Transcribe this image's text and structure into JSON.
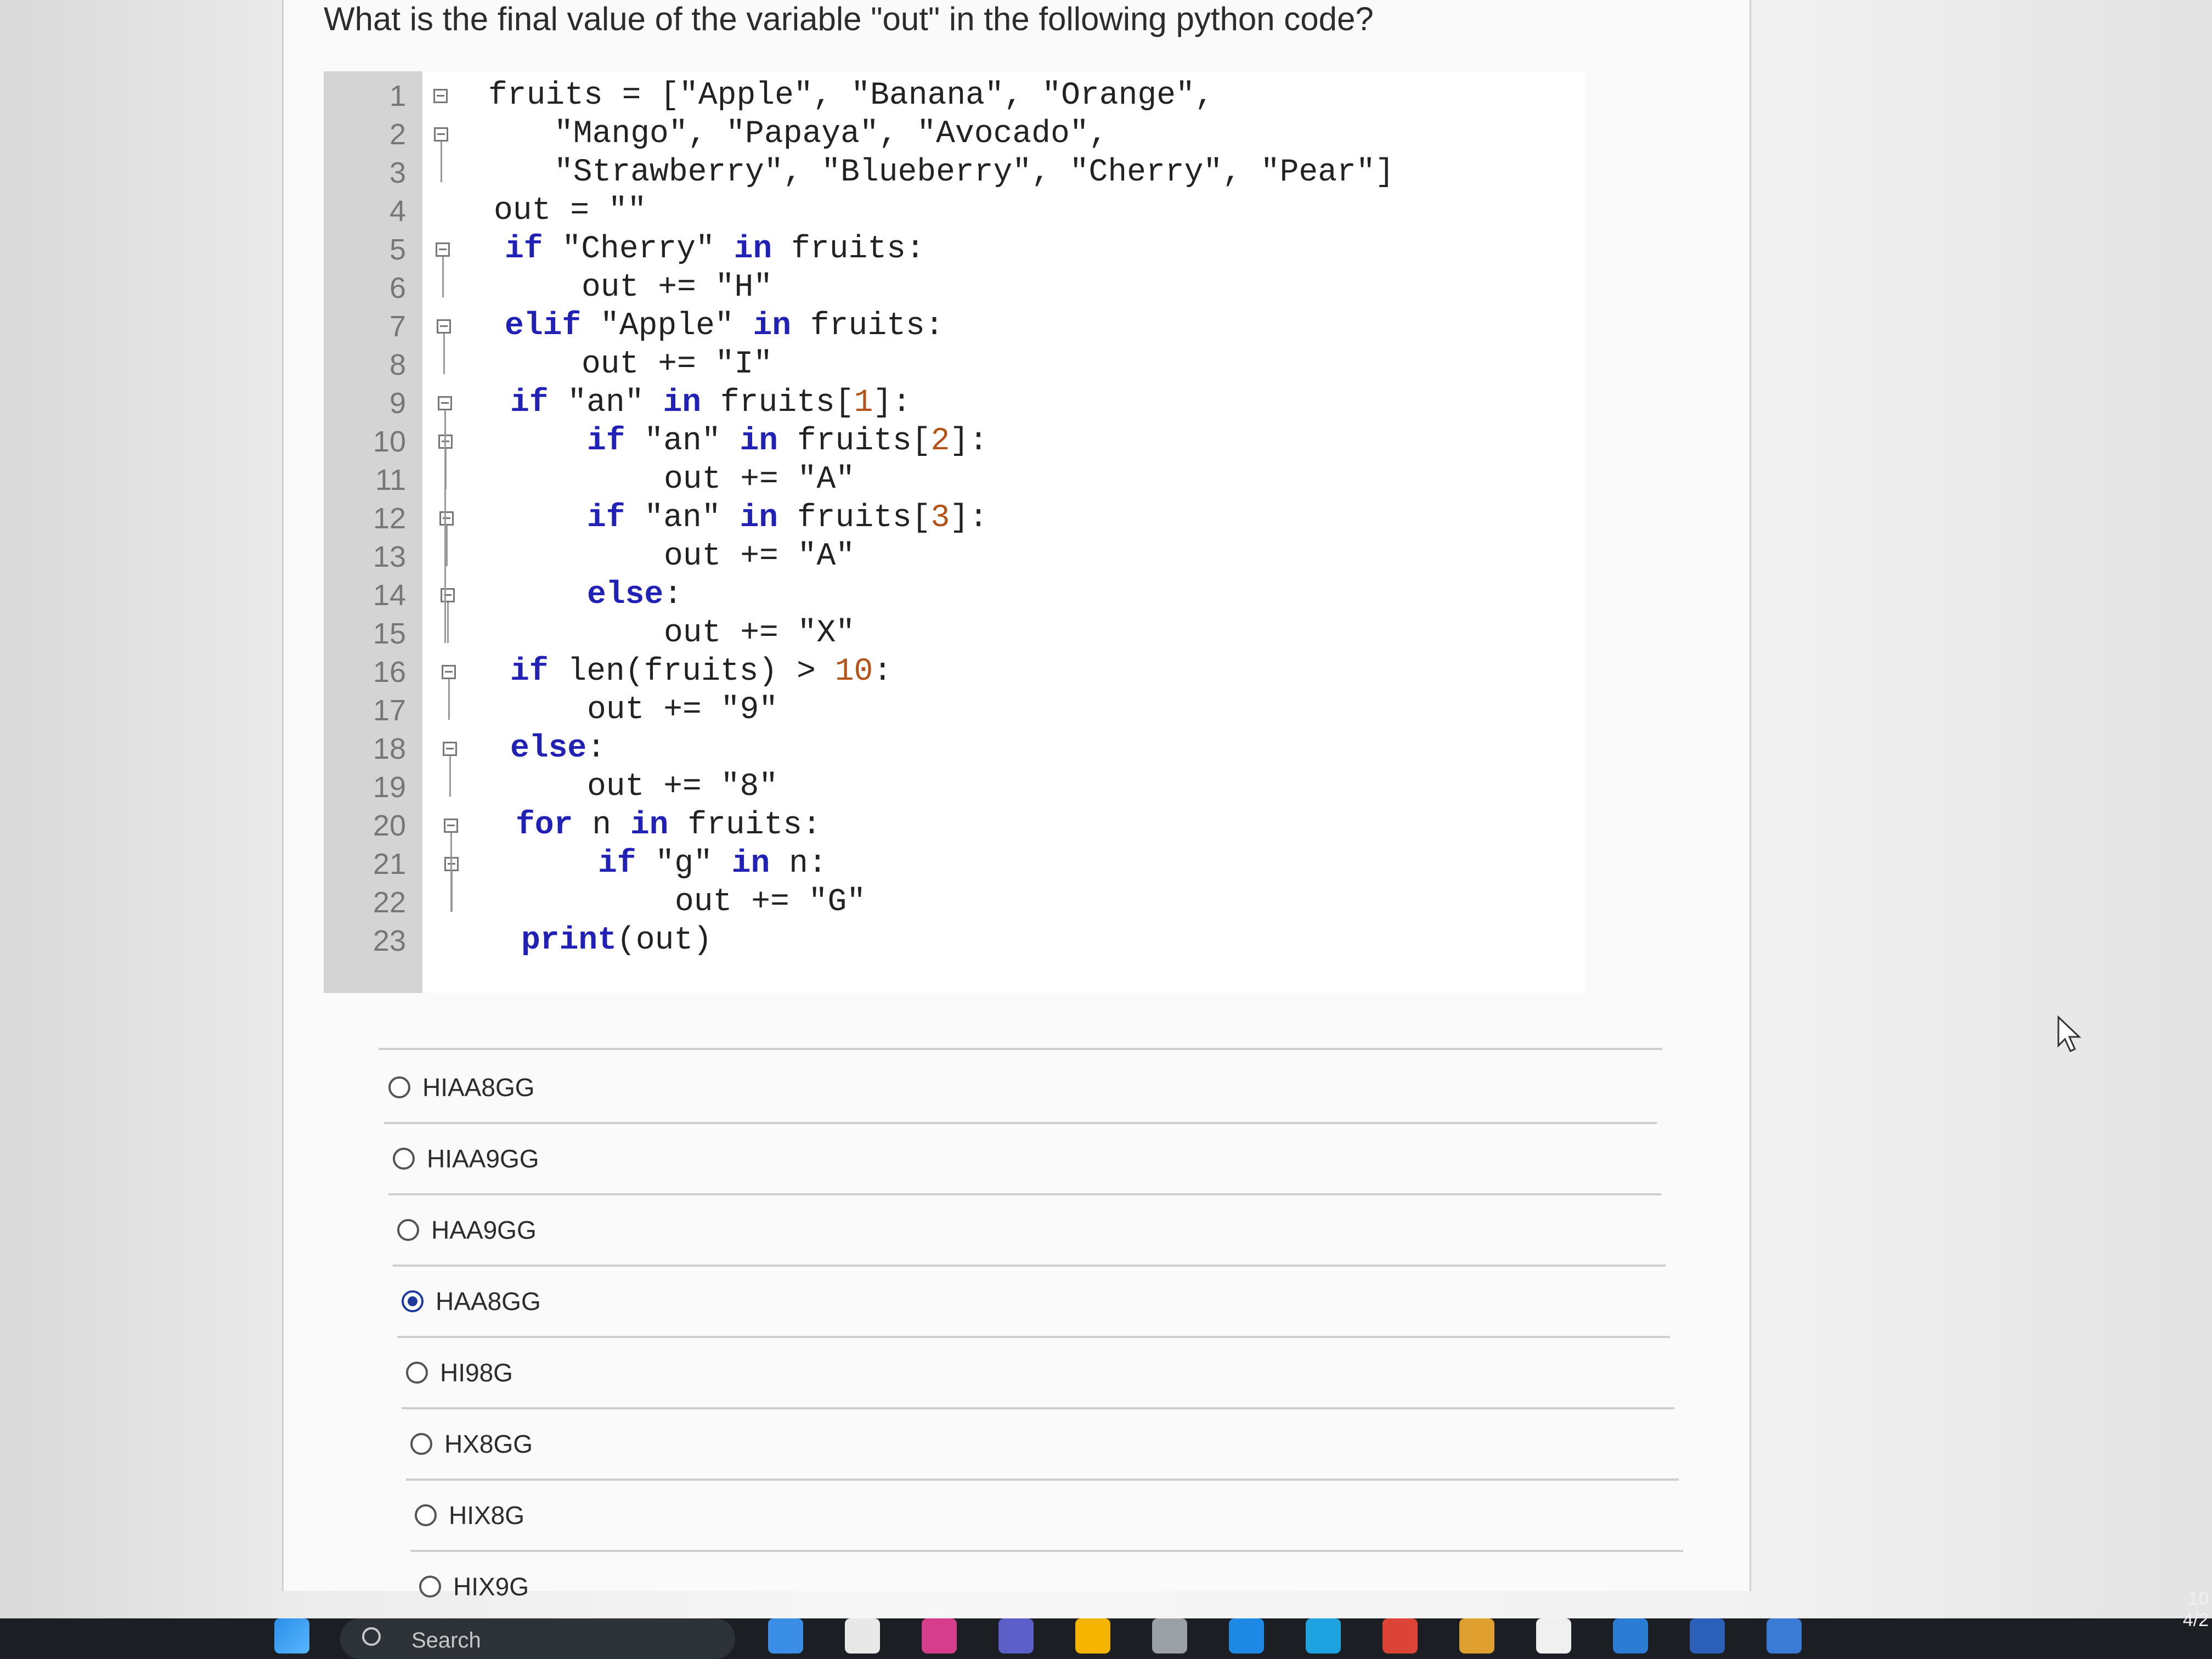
{
  "question": {
    "text": "What is the final value of the variable \"out\" in the following python code?"
  },
  "code": {
    "line_numbers": [
      "1",
      "2",
      "3",
      "4",
      "5",
      "6",
      "7",
      "8",
      "9",
      "10",
      "11",
      "12",
      "13",
      "14",
      "15",
      "16",
      "17",
      "18",
      "19",
      "20",
      "21",
      "22",
      "23"
    ],
    "lines": [
      {
        "parts": [
          {
            "t": "fruits = [\"Apple\", \"Banana\", \"Orange\",",
            "c": ""
          }
        ]
      },
      {
        "parts": [
          {
            "t": "\"Mango\", \"Papaya\", \"Avocado\",",
            "c": ""
          }
        ]
      },
      {
        "parts": [
          {
            "t": "\"Strawberry\", \"Blueberry\", \"Cherry\", \"Pear\"]",
            "c": ""
          }
        ]
      },
      {
        "parts": [
          {
            "t": "out = \"\"",
            "c": ""
          }
        ]
      },
      {
        "parts": [
          {
            "t": "if",
            "c": "kw"
          },
          {
            "t": " \"Cherry\" ",
            "c": ""
          },
          {
            "t": "in",
            "c": "kw"
          },
          {
            "t": " fruits:",
            "c": ""
          }
        ]
      },
      {
        "parts": [
          {
            "t": "out += \"H\"",
            "c": ""
          }
        ]
      },
      {
        "parts": [
          {
            "t": "elif",
            "c": "kw"
          },
          {
            "t": " \"Apple\" ",
            "c": ""
          },
          {
            "t": "in",
            "c": "kw"
          },
          {
            "t": " fruits:",
            "c": ""
          }
        ]
      },
      {
        "parts": [
          {
            "t": "out += \"I\"",
            "c": ""
          }
        ]
      },
      {
        "parts": [
          {
            "t": "if",
            "c": "kw"
          },
          {
            "t": " \"an\" ",
            "c": ""
          },
          {
            "t": "in",
            "c": "kw"
          },
          {
            "t": " fruits[",
            "c": ""
          },
          {
            "t": "1",
            "c": "num"
          },
          {
            "t": "]:",
            "c": ""
          }
        ]
      },
      {
        "parts": [
          {
            "t": "if",
            "c": "kw"
          },
          {
            "t": " \"an\" ",
            "c": ""
          },
          {
            "t": "in",
            "c": "kw"
          },
          {
            "t": " fruits[",
            "c": ""
          },
          {
            "t": "2",
            "c": "num"
          },
          {
            "t": "]:",
            "c": ""
          }
        ]
      },
      {
        "parts": [
          {
            "t": "out += \"A\"",
            "c": ""
          }
        ]
      },
      {
        "parts": [
          {
            "t": "if",
            "c": "kw"
          },
          {
            "t": " \"an\" ",
            "c": ""
          },
          {
            "t": "in",
            "c": "kw"
          },
          {
            "t": " fruits[",
            "c": ""
          },
          {
            "t": "3",
            "c": "num"
          },
          {
            "t": "]:",
            "c": ""
          }
        ]
      },
      {
        "parts": [
          {
            "t": "out += \"A\"",
            "c": ""
          }
        ]
      },
      {
        "parts": [
          {
            "t": "else",
            "c": "kw"
          },
          {
            "t": ":",
            "c": ""
          }
        ]
      },
      {
        "parts": [
          {
            "t": "out += \"X\"",
            "c": ""
          }
        ]
      },
      {
        "parts": [
          {
            "t": "if",
            "c": "kw"
          },
          {
            "t": " len(fruits) > ",
            "c": ""
          },
          {
            "t": "10",
            "c": "num"
          },
          {
            "t": ":",
            "c": ""
          }
        ]
      },
      {
        "parts": [
          {
            "t": "out += \"9\"",
            "c": ""
          }
        ]
      },
      {
        "parts": [
          {
            "t": "else",
            "c": "kw"
          },
          {
            "t": ":",
            "c": ""
          }
        ]
      },
      {
        "parts": [
          {
            "t": "out += \"8\"",
            "c": ""
          }
        ]
      },
      {
        "parts": [
          {
            "t": "for",
            "c": "kw"
          },
          {
            "t": " n ",
            "c": ""
          },
          {
            "t": "in",
            "c": "kw"
          },
          {
            "t": " fruits:",
            "c": ""
          }
        ]
      },
      {
        "parts": [
          {
            "t": "if",
            "c": "kw"
          },
          {
            "t": " \"g\" ",
            "c": ""
          },
          {
            "t": "in",
            "c": "kw"
          },
          {
            "t": " n:",
            "c": ""
          }
        ]
      },
      {
        "parts": [
          {
            "t": "out += \"G\"",
            "c": ""
          }
        ]
      },
      {
        "parts": [
          {
            "t": "print",
            "c": "kw"
          },
          {
            "t": "(out)",
            "c": ""
          }
        ]
      }
    ]
  },
  "options": [
    {
      "label": "HIAA8GG",
      "selected": false
    },
    {
      "label": "HIAA9GG",
      "selected": false
    },
    {
      "label": "HAA9GG",
      "selected": false
    },
    {
      "label": "HAA8GG",
      "selected": true
    },
    {
      "label": "HI98G",
      "selected": false
    },
    {
      "label": "HX8GG",
      "selected": false
    },
    {
      "label": "HIX8G",
      "selected": false
    },
    {
      "label": "HIX9G",
      "selected": false
    }
  ],
  "taskbar": {
    "search_label": "Search",
    "clock_time": "10",
    "clock_date": "4/2",
    "icons": [
      "windows-start-icon",
      "widgets-icon",
      "file-icon",
      "app-icon",
      "teams-icon",
      "file-explorer-icon",
      "store-icon",
      "cortana-icon",
      "edge-icon",
      "chrome-icon",
      "snipping-icon",
      "files-icon",
      "draw-icon",
      "word-icon",
      "viva-icon"
    ],
    "accent": "#1b1f24"
  }
}
